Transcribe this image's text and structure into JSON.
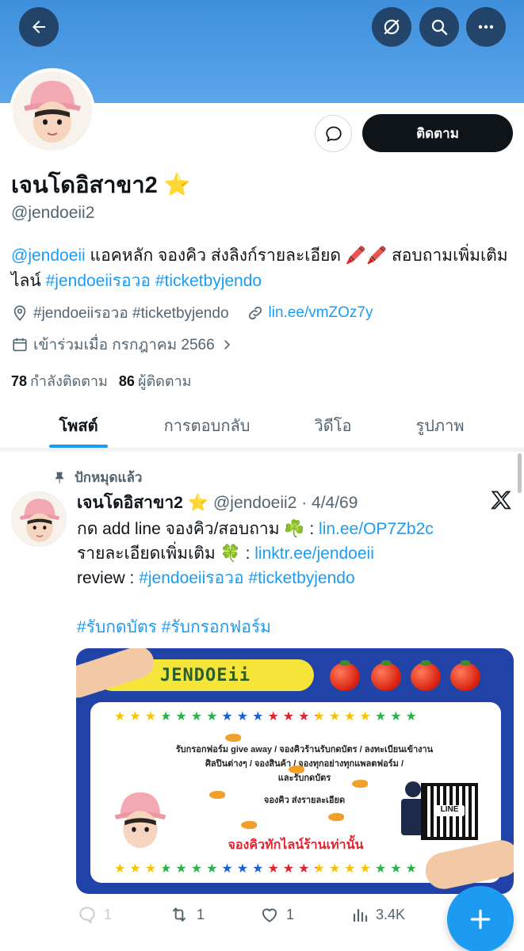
{
  "header": {
    "back_icon": "arrow-left-icon",
    "icons": [
      "no-notification-icon",
      "search-icon",
      "more-icon"
    ]
  },
  "profile": {
    "display_name": "เจนโดอิสาขา2",
    "verified_emoji": "⭐",
    "handle": "@jendoeii2",
    "follow_label": "ติดตาม",
    "bio_mention": "@jendoeii",
    "bio_text": " แอคหลัก จองคิว ส่งลิงก์รายละเอียด 🖍️🖍️ สอบถามเพิ่มเติมไลน์ ",
    "bio_tags": "#jendoeiiรอวอ #ticketbyjendo",
    "location": "#jendoeiiรอวอ #ticketbyjendo",
    "website": "lin.ee/vmZOz7y",
    "joined": "เข้าร่วมเมื่อ กรกฎาคม 2566",
    "following_count": "78",
    "following_label": "กำลังติดตาม",
    "followers_count": "86",
    "followers_label": "ผู้ติดตาม"
  },
  "tabs": [
    {
      "label": "โพสต์"
    },
    {
      "label": "การตอบกลับ"
    },
    {
      "label": "วิดีโอ"
    },
    {
      "label": "รูปภาพ"
    }
  ],
  "tweet": {
    "pinned_label": "ปักหมุดแล้ว",
    "name": "เจนโดอิสาขา2",
    "verified_emoji": "⭐",
    "handle_date": "@jendoeii2 · 4/4/69",
    "line1_text": "กด add line จองคิว/สอบถาม ☘️ : ",
    "line1_link": "lin.ee/OP7Zb2c",
    "line2_text": "รายละเอียดเพิ่มเติม 🍀  : ",
    "line2_link": "linktr.ee/jendoeii",
    "line3_text": "review : ",
    "line3_link": "#jendoeiiรอวอ #ticketbyjendo",
    "line4_link": "#รับกดบัตร #รับกรอกฟอร์ม",
    "media": {
      "brand": "JENDOEii",
      "line_a": "รับกรอกฟอร์ม give away / จองคิวร้านรับกดบัตร / ลงทะเบียนเข้างาน",
      "line_b": "ศิลปินต่างๆ / จองสินค้า / จองทุกอย่างทุกแพลตฟอร์ม /",
      "line_c": "และรับกดบัตร",
      "line_d": "จองคิว ส่งรายละเอียด",
      "cta": "จองคิวทักไลน์ร้านเท่านั้น",
      "qr_label": "LINE",
      "stars": "★★★★★★★★★★★★★★★★★★★★"
    },
    "stats": {
      "replies": "1",
      "retweets": "1",
      "likes": "1",
      "views": "3.4K"
    }
  },
  "colors": {
    "accent": "#1d9bf0",
    "banner": "#4a98e2",
    "text": "#0f1419",
    "muted": "#536471"
  }
}
